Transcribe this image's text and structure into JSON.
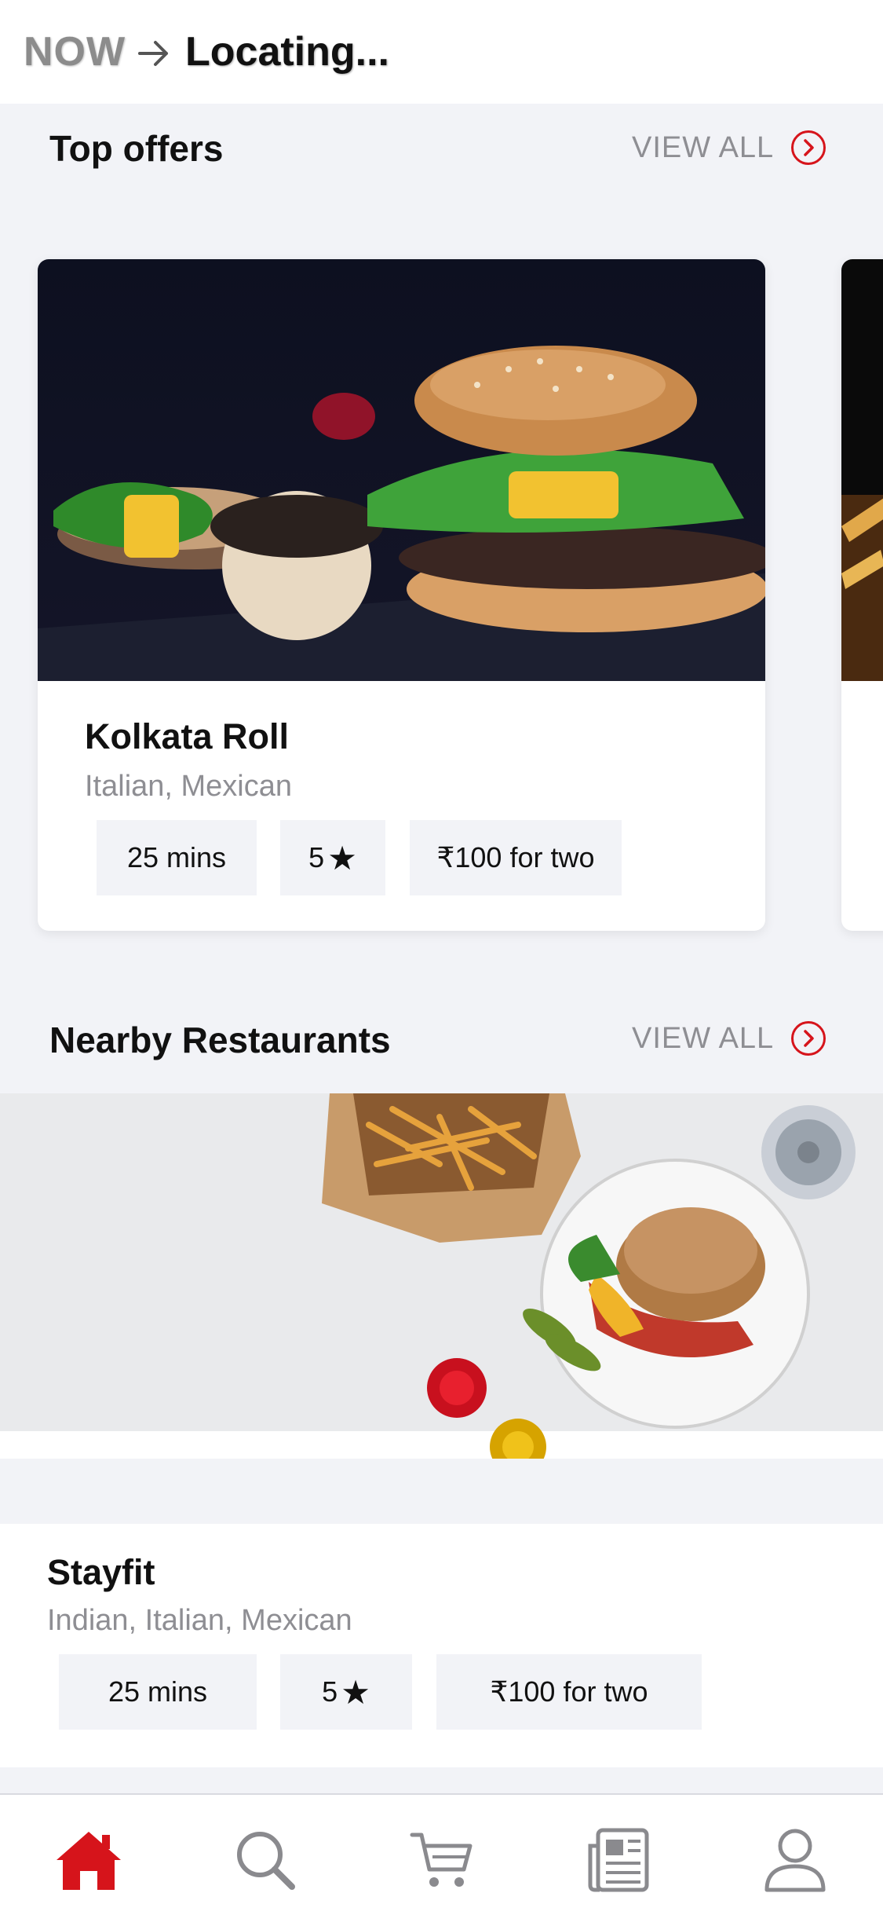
{
  "header": {
    "mode": "NOW",
    "location": "Locating..."
  },
  "top_offers": {
    "title": "Top offers",
    "view_all": "VIEW ALL",
    "cards": [
      {
        "name": "Kolkata Roll",
        "cuisine": "Italian, Mexican",
        "time": "25 mins",
        "rating": "5",
        "price": "₹100 for two"
      }
    ]
  },
  "nearby": {
    "title": "Nearby Restaurants",
    "view_all": "VIEW ALL",
    "restaurants": [
      {
        "name": "Stayfit",
        "cuisine": "Indian, Italian, Mexican",
        "time": "25 mins",
        "rating": "5",
        "price": "₹100 for two"
      }
    ]
  },
  "bottom_nav": {
    "active": "home",
    "items": [
      "home-icon",
      "search-icon",
      "cart-icon",
      "news-icon",
      "profile-icon"
    ]
  },
  "colors": {
    "accent": "#d6141b",
    "background": "#f2f3f7",
    "muted_text": "#8e8e93"
  }
}
